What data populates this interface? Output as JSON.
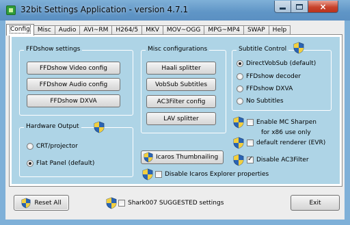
{
  "window": {
    "title": "32bit Settings Application - version 4.7.1",
    "close_glyph": "×"
  },
  "tabs": [
    {
      "label": "Config",
      "active": true
    },
    {
      "label": "Misc"
    },
    {
      "label": "Audio"
    },
    {
      "label": "AVI~RM"
    },
    {
      "label": "H264/5"
    },
    {
      "label": "MKV"
    },
    {
      "label": "MOV~OGG"
    },
    {
      "label": "MPG~MP4"
    },
    {
      "label": "SWAP"
    },
    {
      "label": "Help"
    }
  ],
  "ffdshow": {
    "title": "FFDshow settings",
    "buttons": [
      "FFDshow Video config",
      "FFDshow Audio config",
      "FFDshow DXVA"
    ]
  },
  "misc": {
    "title": "Misc configurations",
    "buttons": [
      "Haali splitter",
      "VobSub Subtitles",
      "AC3Filter config",
      "LAV splitter"
    ]
  },
  "subtitle": {
    "title": "Subtitle Control",
    "options": [
      {
        "label": "DirectVobSub (default)",
        "selected": true
      },
      {
        "label": "FFDshow decoder",
        "selected": false
      },
      {
        "label": "FFDshow DXVA",
        "selected": false
      },
      {
        "label": "No Subtitles",
        "selected": false
      }
    ]
  },
  "hardware": {
    "title": "Hardware Output",
    "options": [
      {
        "label": "CRT/projector",
        "selected": false
      },
      {
        "label": "Flat Panel (default)",
        "selected": true
      }
    ]
  },
  "checks": {
    "mc_sharpen": {
      "label": "Enable MC Sharpen",
      "checked": false
    },
    "mc_sharpen_note": "for x86 use only",
    "default_renderer": {
      "label": "default renderer (EVR)",
      "checked": false
    },
    "disable_ac3": {
      "label": "Disable AC3Filter",
      "checked": true
    },
    "disable_icaros": {
      "label": "Disable Icaros Explorer properties",
      "checked": false
    },
    "shark_suggested": {
      "label": "Shark007 SUGGESTED settings",
      "checked": false
    }
  },
  "icaros_button": "Icaros Thumbnailing",
  "bottom": {
    "reset_label": "Reset All",
    "exit_label": "Exit"
  },
  "colors": {
    "panel_blue": "#aed4e6",
    "titlebar": "#7fb0d8"
  }
}
